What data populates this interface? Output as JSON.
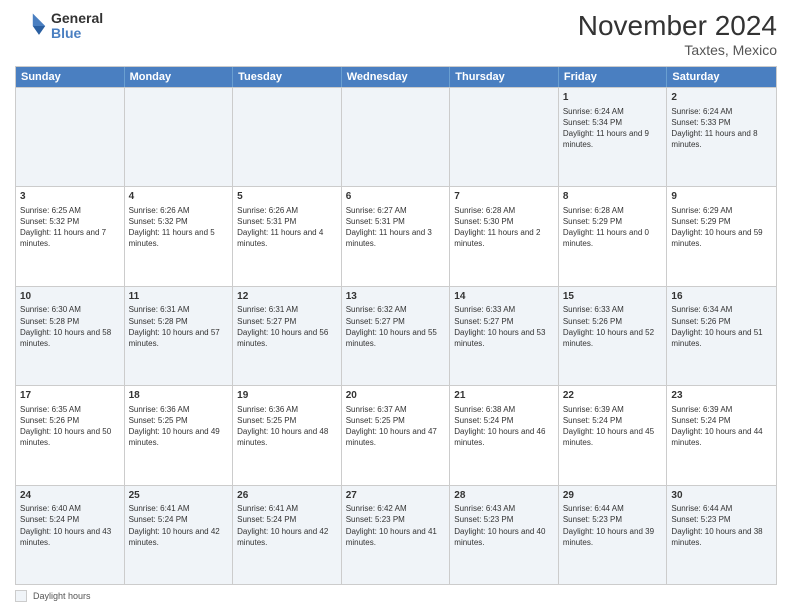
{
  "header": {
    "logo": {
      "general": "General",
      "blue": "Blue"
    },
    "title": "November 2024",
    "subtitle": "Taxtes, Mexico"
  },
  "days_of_week": [
    "Sunday",
    "Monday",
    "Tuesday",
    "Wednesday",
    "Thursday",
    "Friday",
    "Saturday"
  ],
  "weeks": [
    [
      {
        "day": "",
        "info": ""
      },
      {
        "day": "",
        "info": ""
      },
      {
        "day": "",
        "info": ""
      },
      {
        "day": "",
        "info": ""
      },
      {
        "day": "",
        "info": ""
      },
      {
        "day": "1",
        "info": "Sunrise: 6:24 AM\nSunset: 5:34 PM\nDaylight: 11 hours and 9 minutes."
      },
      {
        "day": "2",
        "info": "Sunrise: 6:24 AM\nSunset: 5:33 PM\nDaylight: 11 hours and 8 minutes."
      }
    ],
    [
      {
        "day": "3",
        "info": "Sunrise: 6:25 AM\nSunset: 5:32 PM\nDaylight: 11 hours and 7 minutes."
      },
      {
        "day": "4",
        "info": "Sunrise: 6:26 AM\nSunset: 5:32 PM\nDaylight: 11 hours and 5 minutes."
      },
      {
        "day": "5",
        "info": "Sunrise: 6:26 AM\nSunset: 5:31 PM\nDaylight: 11 hours and 4 minutes."
      },
      {
        "day": "6",
        "info": "Sunrise: 6:27 AM\nSunset: 5:31 PM\nDaylight: 11 hours and 3 minutes."
      },
      {
        "day": "7",
        "info": "Sunrise: 6:28 AM\nSunset: 5:30 PM\nDaylight: 11 hours and 2 minutes."
      },
      {
        "day": "8",
        "info": "Sunrise: 6:28 AM\nSunset: 5:29 PM\nDaylight: 11 hours and 0 minutes."
      },
      {
        "day": "9",
        "info": "Sunrise: 6:29 AM\nSunset: 5:29 PM\nDaylight: 10 hours and 59 minutes."
      }
    ],
    [
      {
        "day": "10",
        "info": "Sunrise: 6:30 AM\nSunset: 5:28 PM\nDaylight: 10 hours and 58 minutes."
      },
      {
        "day": "11",
        "info": "Sunrise: 6:31 AM\nSunset: 5:28 PM\nDaylight: 10 hours and 57 minutes."
      },
      {
        "day": "12",
        "info": "Sunrise: 6:31 AM\nSunset: 5:27 PM\nDaylight: 10 hours and 56 minutes."
      },
      {
        "day": "13",
        "info": "Sunrise: 6:32 AM\nSunset: 5:27 PM\nDaylight: 10 hours and 55 minutes."
      },
      {
        "day": "14",
        "info": "Sunrise: 6:33 AM\nSunset: 5:27 PM\nDaylight: 10 hours and 53 minutes."
      },
      {
        "day": "15",
        "info": "Sunrise: 6:33 AM\nSunset: 5:26 PM\nDaylight: 10 hours and 52 minutes."
      },
      {
        "day": "16",
        "info": "Sunrise: 6:34 AM\nSunset: 5:26 PM\nDaylight: 10 hours and 51 minutes."
      }
    ],
    [
      {
        "day": "17",
        "info": "Sunrise: 6:35 AM\nSunset: 5:26 PM\nDaylight: 10 hours and 50 minutes."
      },
      {
        "day": "18",
        "info": "Sunrise: 6:36 AM\nSunset: 5:25 PM\nDaylight: 10 hours and 49 minutes."
      },
      {
        "day": "19",
        "info": "Sunrise: 6:36 AM\nSunset: 5:25 PM\nDaylight: 10 hours and 48 minutes."
      },
      {
        "day": "20",
        "info": "Sunrise: 6:37 AM\nSunset: 5:25 PM\nDaylight: 10 hours and 47 minutes."
      },
      {
        "day": "21",
        "info": "Sunrise: 6:38 AM\nSunset: 5:24 PM\nDaylight: 10 hours and 46 minutes."
      },
      {
        "day": "22",
        "info": "Sunrise: 6:39 AM\nSunset: 5:24 PM\nDaylight: 10 hours and 45 minutes."
      },
      {
        "day": "23",
        "info": "Sunrise: 6:39 AM\nSunset: 5:24 PM\nDaylight: 10 hours and 44 minutes."
      }
    ],
    [
      {
        "day": "24",
        "info": "Sunrise: 6:40 AM\nSunset: 5:24 PM\nDaylight: 10 hours and 43 minutes."
      },
      {
        "day": "25",
        "info": "Sunrise: 6:41 AM\nSunset: 5:24 PM\nDaylight: 10 hours and 42 minutes."
      },
      {
        "day": "26",
        "info": "Sunrise: 6:41 AM\nSunset: 5:24 PM\nDaylight: 10 hours and 42 minutes."
      },
      {
        "day": "27",
        "info": "Sunrise: 6:42 AM\nSunset: 5:23 PM\nDaylight: 10 hours and 41 minutes."
      },
      {
        "day": "28",
        "info": "Sunrise: 6:43 AM\nSunset: 5:23 PM\nDaylight: 10 hours and 40 minutes."
      },
      {
        "day": "29",
        "info": "Sunrise: 6:44 AM\nSunset: 5:23 PM\nDaylight: 10 hours and 39 minutes."
      },
      {
        "day": "30",
        "info": "Sunrise: 6:44 AM\nSunset: 5:23 PM\nDaylight: 10 hours and 38 minutes."
      }
    ]
  ],
  "legend": {
    "box_label": "Daylight hours"
  }
}
